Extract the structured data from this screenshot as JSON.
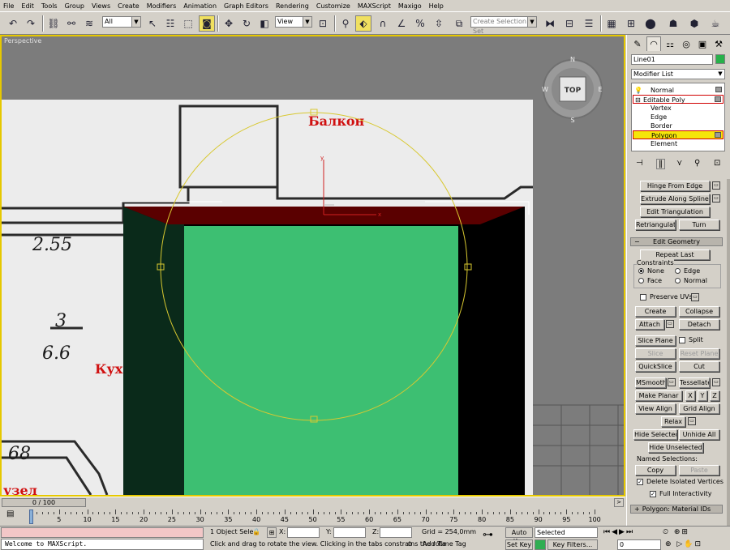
{
  "menu": [
    "File",
    "Edit",
    "Tools",
    "Group",
    "Views",
    "Create",
    "Modifiers",
    "Animation",
    "Graph Editors",
    "Rendering",
    "Customize",
    "MAXScript",
    "Maxigo",
    "Help"
  ],
  "toolbar": {
    "selection_filter": "All",
    "ref_coord": "View",
    "named_selection_placeholder": "Create Selection Set",
    "undo_icon": "undo-icon",
    "redo_icon": "redo-icon"
  },
  "viewport": {
    "label": "Perspective",
    "viewcube_label": "TOP",
    "compass": {
      "n": "N",
      "w": "W",
      "e": "E",
      "s": "S"
    },
    "sketch_texts": {
      "balcony": "Балкон",
      "dim1": "2.55",
      "dim2_num": "3",
      "dim2_den": "6.6",
      "kitchen": "Кух",
      "dim3": "68",
      "node": "узел"
    },
    "gizmo": {
      "x": "x",
      "y": "y"
    },
    "colors": {
      "bg": "#7c7c7c",
      "border": "#e6c800",
      "front_face": "#3dbf72",
      "side_face": "#0a2a1a",
      "top_face": "#5a0000",
      "gizmo_circle": "#d8c830"
    }
  },
  "timeline": {
    "slider_label": "0 / 100",
    "ticks": [
      0,
      5,
      10,
      15,
      20,
      25,
      30,
      35,
      40,
      45,
      50,
      55,
      60,
      65,
      70,
      75,
      80,
      85,
      90,
      95,
      100
    ]
  },
  "status": {
    "maxscript_text": "Welcome to MAXScript.",
    "selection_info": "1 Object Sele",
    "x_label": "X:",
    "y_label": "Y:",
    "z_label": "Z:",
    "grid": "Grid = 254,0mm",
    "prompt": "Click and drag to rotate the view.  Clicking in the tabs constrains the rota",
    "add_time_tag": "Add Time Tag",
    "auto_key": "Auto Key",
    "set_key": "Set Key",
    "key_mode": "Selected",
    "key_filters": "Key Filters...",
    "frame": "0"
  },
  "command_panel": {
    "object_name": "Line01",
    "object_color": "#27b14a",
    "modifier_list": "Modifier List",
    "stack": [
      {
        "label": "Normal",
        "level": "top"
      },
      {
        "label": "Editable Poly",
        "level": "top"
      },
      {
        "label": "Vertex",
        "level": "sub"
      },
      {
        "label": "Edge",
        "level": "sub"
      },
      {
        "label": "Border",
        "level": "sub"
      },
      {
        "label": "Polygon",
        "level": "sub"
      },
      {
        "label": "Element",
        "level": "sub"
      }
    ],
    "buttons": {
      "hinge_from_edge": "Hinge From Edge",
      "extrude_along_spline": "Extrude Along Spline",
      "edit_triangulation": "Edit Triangulation",
      "retriangulate": "Retriangulate",
      "turn": "Turn",
      "repeat_last": "Repeat Last",
      "create": "Create",
      "collapse": "Collapse",
      "attach": "Attach",
      "detach": "Detach",
      "slice_plane": "Slice Plane",
      "split": "Split",
      "slice": "Slice",
      "reset_plane": "Reset Plane",
      "quickslice": "QuickSlice",
      "cut": "Cut",
      "msmooth": "MSmooth",
      "tessellate": "Tessellate",
      "make_planar": "Make Planar",
      "x": "X",
      "y": "Y",
      "z": "Z",
      "view_align": "View Align",
      "grid_align": "Grid Align",
      "relax": "Relax",
      "hide_selected": "Hide Selected",
      "unhide_all": "Unhide All",
      "hide_unselected": "Hide Unselected",
      "copy": "Copy",
      "paste": "Paste"
    },
    "rollouts": {
      "edit_geometry": "Edit Geometry",
      "material_ids": "Polygon: Material IDs"
    },
    "labels": {
      "constraints": "Constraints",
      "none": "None",
      "edge": "Edge",
      "face": "Face",
      "normal": "Normal",
      "preserve_uvs": "Preserve UVs",
      "named_selections": "Named Selections:",
      "delete_isolated": "Delete Isolated Vertices",
      "full_interactivity": "Full Interactivity"
    }
  }
}
